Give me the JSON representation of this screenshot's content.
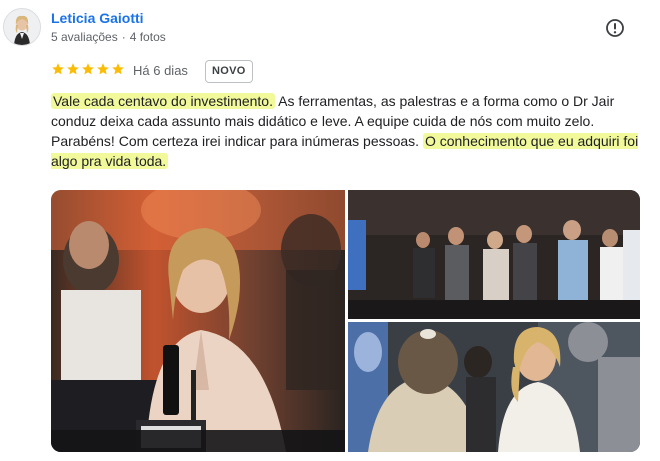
{
  "reviewer": {
    "name": "Leticia Gaiotti",
    "reviews_count": "5 avaliações",
    "separator": "·",
    "photos_count": "4 fotos"
  },
  "rating": {
    "stars": 5,
    "max": 5,
    "color": "#fbbc04"
  },
  "review_age": "Há 6 dias",
  "badge": "NOVO",
  "review": {
    "highlight_1": "Vale cada centavo do investimento.",
    "text_1": " As ferramentas, as palestras e a forma como o Dr Jair conduz deixa cada assunto mais didático e leve. A equipe cuida de nós com muito zelo. Parabéns! Com certeza irei indicar para inúmeras pessoas. ",
    "highlight_2": "O conhecimento que eu adquiri foi algo pra vida toda."
  },
  "icons": {
    "report": "report-flag-icon",
    "star": "star-icon"
  },
  "colors": {
    "name": "#1a73e8",
    "highlight": "#f1f99b",
    "meta": "#5f6368"
  }
}
